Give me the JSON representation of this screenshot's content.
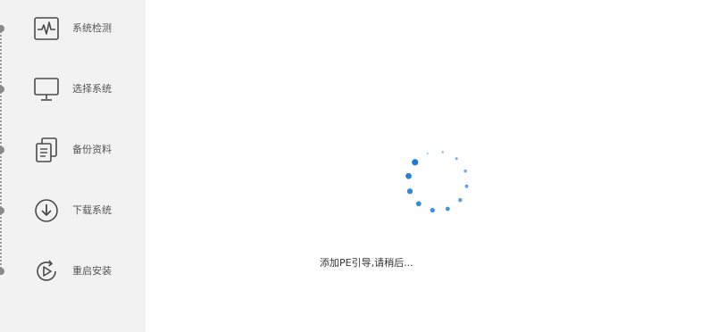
{
  "sidebar": {
    "steps": [
      {
        "label": "系统检测",
        "icon": "heartbeat-monitor-icon"
      },
      {
        "label": "选择系统",
        "icon": "desktop-monitor-icon"
      },
      {
        "label": "备份资料",
        "icon": "copy-documents-icon"
      },
      {
        "label": "下载系统",
        "icon": "download-circle-icon"
      },
      {
        "label": "重启安装",
        "icon": "restart-play-icon"
      }
    ]
  },
  "main": {
    "status_text": "添加PE引导,请稍后..."
  },
  "colors": {
    "spinner_blue": "#1e7bd4",
    "sidebar_bg": "#f2f2f2",
    "icon_stroke": "#4a4a4a"
  }
}
